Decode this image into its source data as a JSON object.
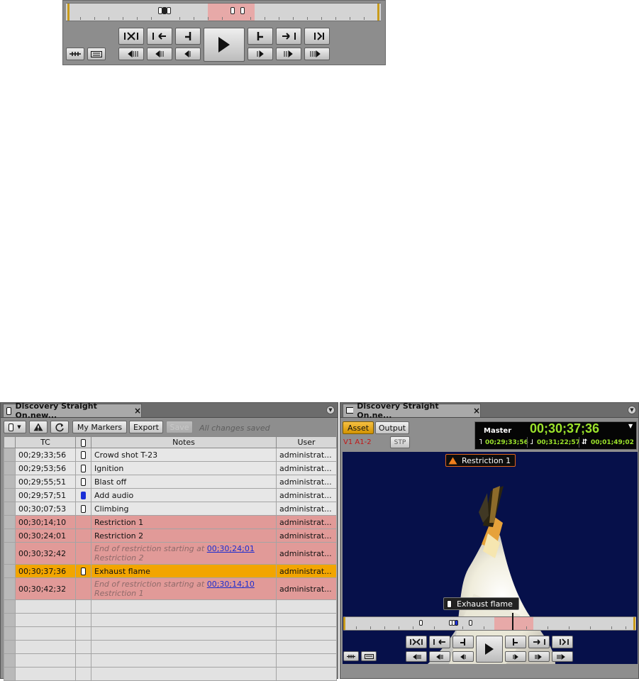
{
  "left_panel": {
    "tab_title": "Discovery Straight On.new...",
    "toolbar": {
      "my_markers_label": "My Markers",
      "export_label": "Export",
      "save_label": "Save",
      "status_text": "All changes saved"
    },
    "columns": [
      "TC",
      "",
      "Notes",
      "User"
    ],
    "rows": [
      {
        "tc": "00;29;33;56",
        "marker": "white",
        "notes": "Crowd shot T-23",
        "user": "administrat...",
        "state": "normal"
      },
      {
        "tc": "00;29;53;56",
        "marker": "white",
        "notes": "Ignition",
        "user": "administrat...",
        "state": "normal"
      },
      {
        "tc": "00;29;55;51",
        "marker": "white",
        "notes": "Blast off",
        "user": "administrat...",
        "state": "normal"
      },
      {
        "tc": "00;29;57;51",
        "marker": "blue",
        "notes": "Add audio",
        "user": "administrat...",
        "state": "normal"
      },
      {
        "tc": "00;30;07;53",
        "marker": "white",
        "notes": "Climbing",
        "user": "administrat...",
        "state": "normal"
      },
      {
        "tc": "00;30;14;10",
        "marker": "",
        "notes": "Restriction 1",
        "user": "administrat...",
        "state": "restriction"
      },
      {
        "tc": "00;30;24;01",
        "marker": "",
        "notes": "Restriction 2",
        "user": "administrat...",
        "state": "restriction"
      },
      {
        "tc": "00;30;32;42",
        "marker": "",
        "notes_prefix": "End of restriction starting at ",
        "notes_link": "00;30;24;01",
        "notes_suffix": " Restriction 2",
        "user": "administrat...",
        "state": "restriction"
      },
      {
        "tc": "00;30;37;36",
        "marker": "white",
        "notes": "Exhaust flame",
        "user": "administrat...",
        "state": "selected"
      },
      {
        "tc": "00;30;42;32",
        "marker": "",
        "notes_prefix": "End of restriction starting at ",
        "notes_link": "00;30;14;10",
        "notes_suffix": " Restriction 1",
        "user": "administrat...",
        "state": "restriction"
      }
    ]
  },
  "right_panel": {
    "tab_title": "Discovery Straight On.ne...",
    "asset_label": "Asset",
    "output_label": "Output",
    "track_label": "V1 A1-2",
    "stp_label": "STP",
    "timecode": {
      "label": "Master",
      "main": "00;30;37;36",
      "mark_in": "00;29;33;56",
      "mark_out": "00;31;22;57",
      "duration": "00;01;49;02"
    },
    "restriction_label": "Restriction 1",
    "marker_caption": "Exhaust flame"
  },
  "colors": {
    "restriction_row": "#e19a98",
    "selected_row": "#f2a500",
    "timecode_green": "#9be22b",
    "video_bg": "#06104a"
  },
  "icons": [
    "marker-icon",
    "alert-icon",
    "refresh-icon",
    "close-icon",
    "panel-menu-icon",
    "play-icon",
    "step-forward-icon",
    "step-back-icon",
    "mark-in-icon",
    "mark-out-icon",
    "warning-icon"
  ]
}
